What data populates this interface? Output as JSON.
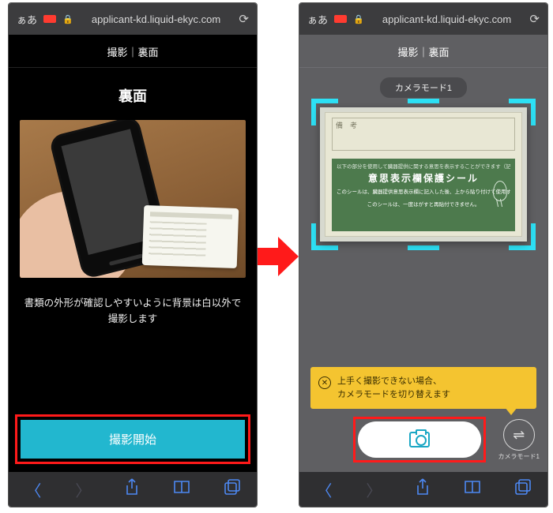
{
  "browser": {
    "aa": "ぁあ",
    "url": "applicant-kd.liquid-ekyc.com"
  },
  "left": {
    "title_bar": "撮影｜裏面",
    "subtitle": "裏面",
    "instruction": "書類の外形が確認しやすいように背景は白以外で撮影します",
    "start_button": "撮影開始"
  },
  "right": {
    "title_bar": "撮影｜裏面",
    "mode_pill": "カメラモード1",
    "card": {
      "bikou_label": "備　考",
      "green_note": "以下の部分を使用して臓器提供に関する意思を表示することができます（記入は自由です。）",
      "green_title": "意思表示欄保護シール",
      "green_line1": "このシールは、臓器提供意思表示欄に記入した後、上から貼り付けて使用することができます。",
      "green_line2": "このシールは、一度はがすと再貼付できません。"
    },
    "tip_line1": "上手く撮影できない場合、",
    "tip_line2": "カメラモードを切り替えます",
    "mode_switch_label": "カメラモード1"
  }
}
